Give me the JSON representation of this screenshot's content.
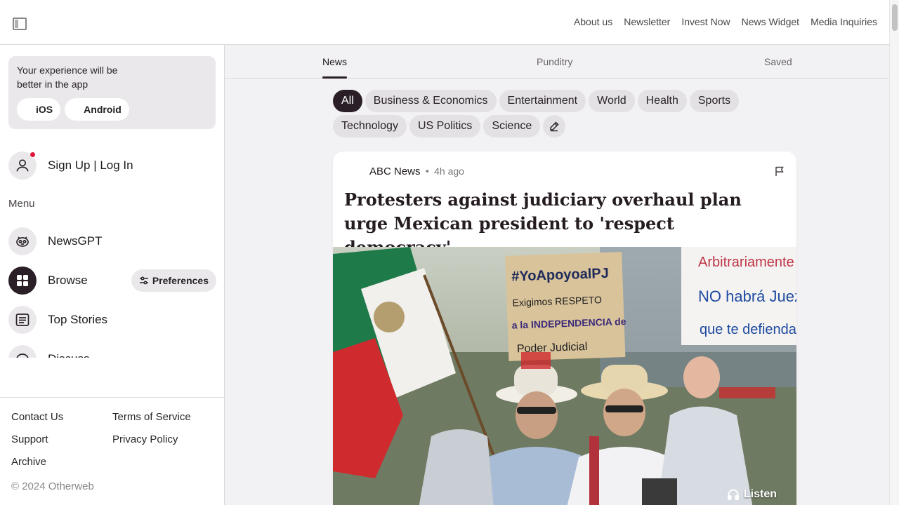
{
  "topnav": {
    "items": [
      "About us",
      "Newsletter",
      "Invest Now",
      "News Widget",
      "Media Inquiries"
    ]
  },
  "sidebar": {
    "promo_text": "Your experience will be better in the app",
    "ios_label": "iOS",
    "android_label": "Android",
    "signin_label": "Sign Up | Log In",
    "menu_heading": "Menu",
    "menu_items": [
      {
        "label": "NewsGPT",
        "icon": "robot-icon"
      },
      {
        "label": "Browse",
        "icon": "grid-icon"
      },
      {
        "label": "Top Stories",
        "icon": "list-icon"
      },
      {
        "label": "Discuss",
        "icon": "chat-icon"
      }
    ],
    "preferences_label": "Preferences",
    "footer": {
      "links": [
        "Contact Us",
        "Terms of Service",
        "Support",
        "Privacy Policy",
        "Archive"
      ],
      "copyright": "© 2024 Otherweb"
    }
  },
  "tabs": [
    "News",
    "Punditry",
    "Saved"
  ],
  "categories": [
    "All",
    "Business & Economics",
    "Entertainment",
    "World",
    "Health",
    "Sports",
    "Technology",
    "US Politics",
    "Science"
  ],
  "article": {
    "source": "ABC News",
    "separator": "•",
    "time": "4h ago",
    "headline": "Protesters against judiciary overhaul plan urge Mexican president to 'respect democracy'",
    "listen_label": "Listen",
    "sign1": {
      "line1": "#YoApoyoalPJ",
      "line2": "Exigimos RESPETO",
      "line3": "a la INDEPENDENCIA de",
      "line4": "Poder Judicial"
    },
    "sign2": {
      "line1": "Arbitrariamente",
      "line2": "NO habrá Juez",
      "line3": "que te defienda"
    }
  },
  "colors": {
    "accent_dark": "#2b1f27",
    "notification": "#e0153b",
    "chip_bg": "#e4e1e4"
  }
}
